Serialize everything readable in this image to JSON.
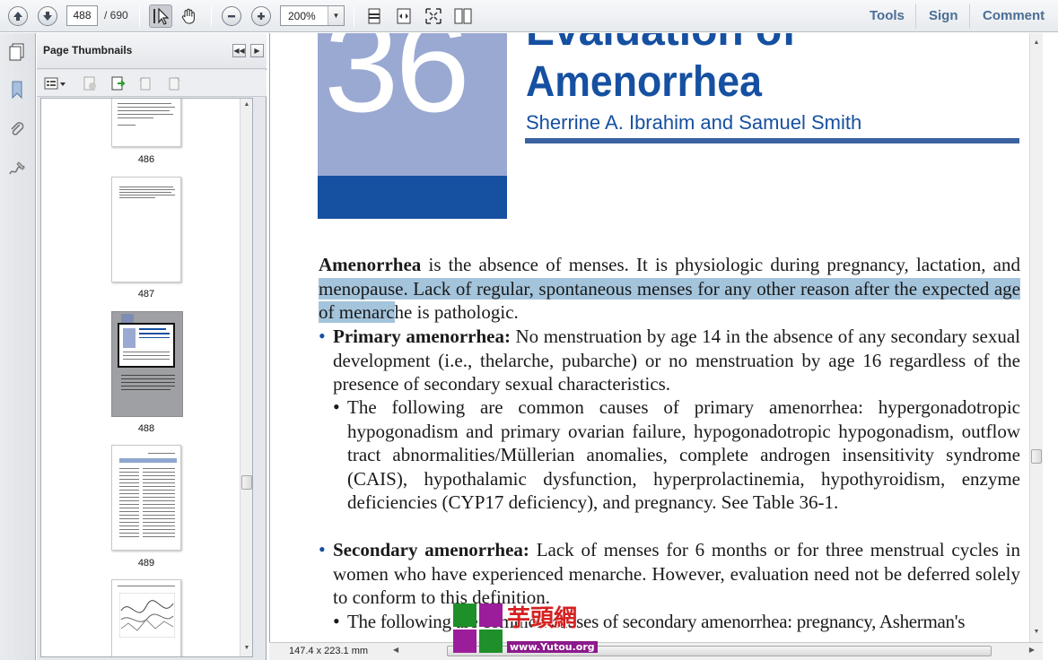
{
  "toolbar": {
    "current_page": "488",
    "page_total": "/ 690",
    "zoom": "200%",
    "links": {
      "tools": "Tools",
      "sign": "Sign",
      "comment": "Comment"
    }
  },
  "sidebar": {
    "rail_icons": [
      "pages-icon",
      "bookmark-icon",
      "attachment-icon",
      "signature-icon"
    ],
    "panel_title": "Page Thumbnails",
    "thumbnails": [
      {
        "label": "486"
      },
      {
        "label": "487"
      },
      {
        "label": "488",
        "selected": true
      },
      {
        "label": "489"
      }
    ]
  },
  "document": {
    "chapter_number": "36",
    "title_line1": "Evaluation of",
    "title_line2": "Amenorrhea",
    "authors": "Sherrine A. Ibrahim and Samuel Smith",
    "intro_term": "Amenorrhea",
    "intro_rest_1": " is the absence of menses. It is physiologic during pregnancy, lactation, and",
    "intro_highlighted": " menopause. Lack of regular, spontaneous menses for any other reason after the expected age of menarc",
    "intro_rest_2": "he is pathologic.",
    "bullet1_term": "Primary amenorrhea:",
    "bullet1_text": " No menstruation by age 14 in the absence of any secondary sexual development (i.e., thelarche, pubarche) or no menstruation by age 16 regardless of the presence of secondary sexual characteristics.",
    "subbullet1_text": "The following are common causes of primary amenorrhea: hypergonadotropic hypogonadism and primary ovarian failure, hypogonadotropic hypogonadism, outflow tract abnormalities/Müllerian anomalies, complete androgen insensitivity syndrome (CAIS), hypothalamic dysfunction, hyperprolactinemia, hypothyroidism, enzyme deficiencies (CYP17 deficiency), and pregnancy. See Table 36-1.",
    "bullet2_term": "Secondary amenorrhea:",
    "bullet2_text": " Lack of menses for 6 months or for three menstrual cycles in women who have experienced menarche. However, evaluation need not be deferred solely to conform to this definition.",
    "subbullet2_text": "The following are common causes of secondary amenorrhea: pregnancy, Asherman's"
  },
  "status": {
    "page_size": "147.4 x 223.1 mm"
  },
  "watermark": {
    "text": "芋頭網",
    "url": "www.Yutou.org"
  }
}
